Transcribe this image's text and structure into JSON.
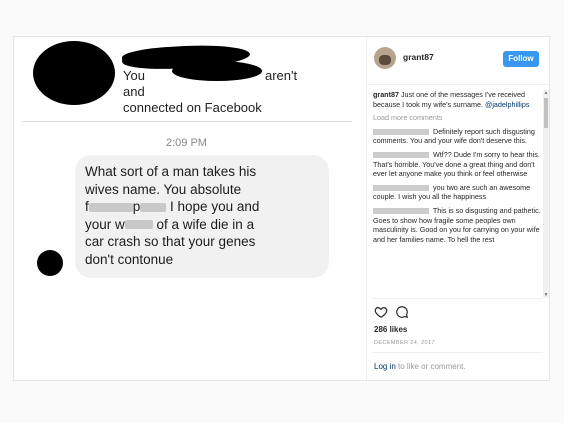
{
  "message_screenshot": {
    "notice_prefix": "You and",
    "notice_suffix": "aren't",
    "notice_line2": "connected on Facebook",
    "time": "2:09 PM",
    "message": {
      "l1": "What sort of a man takes his",
      "l2": "wives name. You absolute",
      "l3a": "f",
      "l3b": "p",
      "l3c": " I hope you and",
      "l4a": "your w",
      "l4b": " of a wife die in a",
      "l5": "car crash so that your genes",
      "l6": "don't contonue"
    }
  },
  "post": {
    "username": "grant87",
    "follow_label": "Follow",
    "caption_user": "grant87",
    "caption_text": " Just one of the messages I've received because I took my wife's surname. ",
    "caption_mention": "@jadelphillips",
    "load_more": "Load more comments",
    "comments": [
      {
        "text": " Definitely report such disgusting comments. You and your wife don't deserve this."
      },
      {
        "text": " Wtf?? Dude I'm sorry to hear this. That's horrible. You've done a great thing and don't ever let anyone make you think or feel otherwise"
      },
      {
        "text": " you two are such an awesome couple. I wish you all the happiness"
      },
      {
        "text": " This is so disgusting and pathetic. Goes to show how fragile some peoples own masculinity is. Good on you for carrying on your wife and her families name. To hell the rest"
      }
    ],
    "likes": "286 likes",
    "date": "DECEMBER 24, 2017",
    "login_link": "Log in",
    "login_rest": " to like or comment."
  }
}
